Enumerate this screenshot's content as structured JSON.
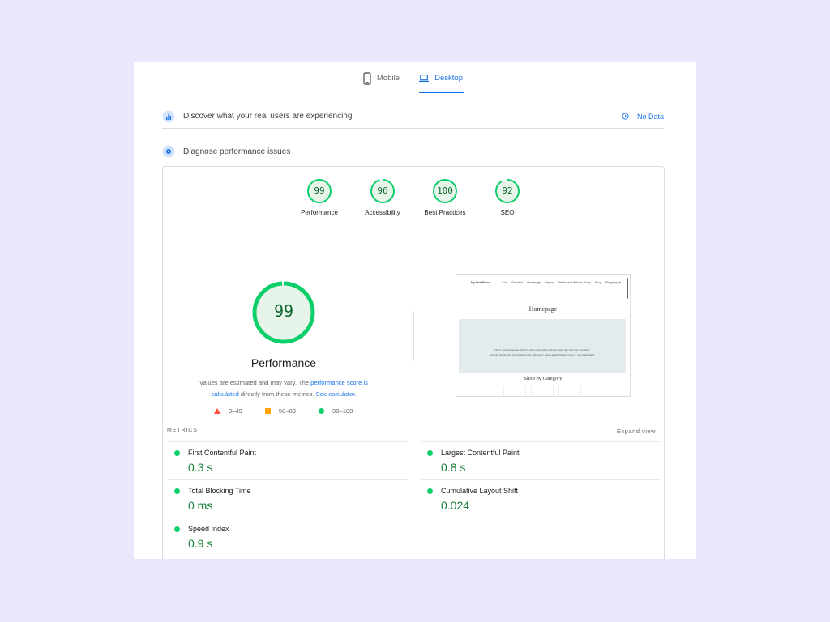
{
  "tabs": {
    "mobile": "Mobile",
    "desktop": "Desktop"
  },
  "real_users": {
    "title": "Discover what your real users are experiencing",
    "status": "No Data"
  },
  "diagnose": {
    "title": "Diagnose performance issues"
  },
  "categories": [
    {
      "score": "99",
      "label": "Performance"
    },
    {
      "score": "96",
      "label": "Accessibility"
    },
    {
      "score": "100",
      "label": "Best Practices"
    },
    {
      "score": "92",
      "label": "SEO"
    }
  ],
  "main": {
    "score": "99",
    "title": "Performance",
    "note_prefix": "Values are estimated and may vary. The ",
    "note_link1": "performance score is calculated",
    "note_middle": " directly from these metrics. ",
    "note_link2": "See calculator."
  },
  "legend": {
    "fail": "0–49",
    "average": "50–89",
    "pass": "90–100"
  },
  "preview": {
    "brand": "My WordPress",
    "nav": [
      "Cart",
      "Checkout",
      "Homepage",
      "Moyvax",
      "Refund and Returns Policy",
      "Shop",
      "Shopping list"
    ],
    "page_title": "Homepage",
    "hero_line1": "This is your homepage which is what most visitors will see when they first visit your shop.",
    "hero_line2": "You can change this text by editing the \"Welcome\" page via the \"Pages\" menu in your dashboard.",
    "shop_title": "Shop by Category"
  },
  "metrics": {
    "header": "METRICS",
    "expand": "Expand view",
    "items": [
      {
        "name": "First Contentful Paint",
        "value": "0.3 s"
      },
      {
        "name": "Largest Contentful Paint",
        "value": "0.8 s"
      },
      {
        "name": "Total Blocking Time",
        "value": "0 ms"
      },
      {
        "name": "Cumulative Layout Shift",
        "value": "0.024"
      },
      {
        "name": "Speed Index",
        "value": "0.9 s"
      }
    ]
  },
  "colors": {
    "pass": "#0cce6b",
    "average": "#ffa400",
    "fail": "#ff4e42",
    "accent": "#1a73e8",
    "background": "#ece6fc"
  }
}
